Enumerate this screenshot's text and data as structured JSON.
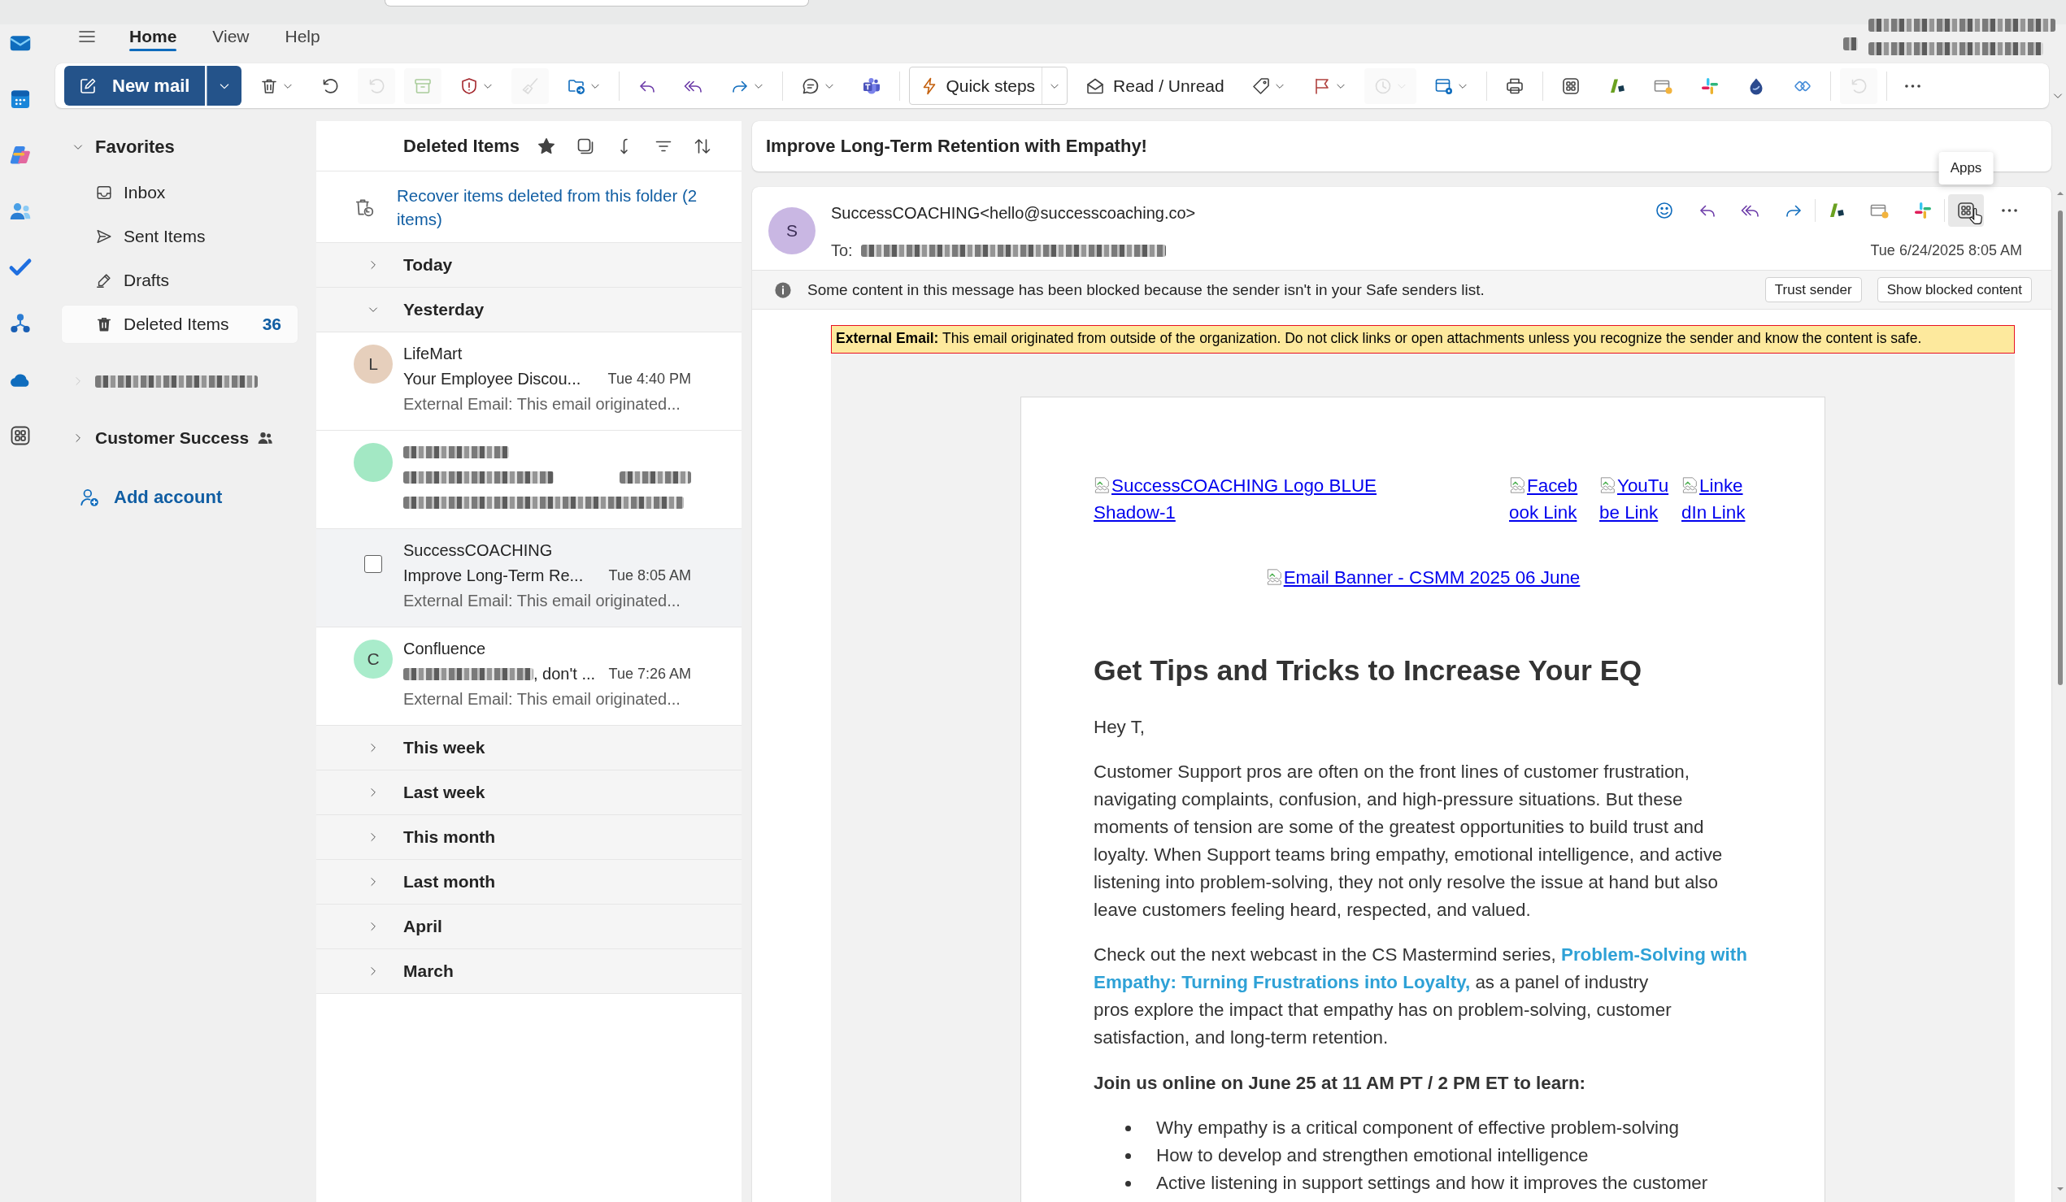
{
  "ribbon": {
    "tabs": [
      {
        "label": "Home",
        "selected": true
      },
      {
        "label": "View",
        "selected": false
      },
      {
        "label": "Help",
        "selected": false
      }
    ],
    "account_blurred": true
  },
  "toolbar": {
    "groups": [
      [
        {
          "kind": "primary",
          "label": "New mail",
          "menu": true,
          "disabled": false
        },
        {
          "kind": "icon",
          "menu": true,
          "disabled": false
        },
        {
          "kind": "icon",
          "menu": false,
          "disabled": false
        },
        {
          "kind": "icon",
          "menu": false,
          "disabled": true
        },
        {
          "kind": "icon",
          "menu": false,
          "disabled": true
        },
        {
          "kind": "icon",
          "menu": true,
          "disabled": false
        },
        {
          "kind": "icon",
          "menu": false,
          "disabled": true
        },
        {
          "kind": "icon",
          "menu": true,
          "disabled": false
        }
      ],
      [
        {
          "kind": "icon",
          "menu": false,
          "disabled": false
        },
        {
          "kind": "icon",
          "menu": false,
          "disabled": false
        },
        {
          "kind": "icon",
          "menu": true,
          "disabled": false
        }
      ],
      [
        {
          "kind": "icon",
          "menu": true,
          "disabled": false
        },
        {
          "kind": "icon",
          "menu": false,
          "disabled": false
        }
      ],
      [
        {
          "kind": "outlined",
          "label": "Quick steps",
          "menu": true,
          "disabled": false
        },
        {
          "kind": "text",
          "label": "Read / Unread",
          "menu": false,
          "disabled": false
        },
        {
          "kind": "icon",
          "menu": true,
          "disabled": false
        },
        {
          "kind": "icon",
          "menu": true,
          "disabled": false
        },
        {
          "kind": "icon",
          "menu": true,
          "disabled": true
        },
        {
          "kind": "icon",
          "menu": true,
          "disabled": false
        }
      ],
      [
        {
          "kind": "icon",
          "menu": false,
          "disabled": false
        }
      ],
      [
        {
          "kind": "icon",
          "menu": false,
          "disabled": false
        },
        {
          "kind": "icon",
          "menu": false,
          "disabled": false
        },
        {
          "kind": "icon",
          "menu": false,
          "disabled": false
        },
        {
          "kind": "icon",
          "menu": false,
          "disabled": false
        },
        {
          "kind": "icon",
          "menu": false,
          "disabled": false
        },
        {
          "kind": "icon",
          "menu": false,
          "disabled": false
        }
      ],
      [
        {
          "kind": "icon",
          "menu": false,
          "disabled": true
        }
      ],
      [
        {
          "kind": "icon",
          "menu": false,
          "disabled": false
        }
      ]
    ]
  },
  "folder_pane": {
    "favorites": {
      "label": "Favorites",
      "expanded": true,
      "items": [
        {
          "label": "Inbox",
          "selected": false
        },
        {
          "label": "Sent Items",
          "selected": false
        },
        {
          "label": "Drafts",
          "selected": false
        },
        {
          "label": "Deleted Items",
          "selected": true,
          "count": "36"
        }
      ]
    },
    "accounts": [
      {
        "kind": "redacted",
        "expanded": false
      },
      {
        "kind": "group",
        "label": "Customer Success",
        "expanded": false
      }
    ],
    "add_account": "Add account"
  },
  "message_list": {
    "title": "Deleted Items",
    "favorite": true,
    "recover_link": "Recover items deleted from this folder (2 items)",
    "groups": [
      {
        "label": "Today",
        "expanded": false
      },
      {
        "label": "Yesterday",
        "expanded": true,
        "messages": [
          {
            "kind": "mail",
            "sender": "LifeMart",
            "subject": "Your Employee Discou...",
            "time": "Tue 4:40 PM",
            "preview": "External Email: This email originated...",
            "initial": "L",
            "color": "#e6cfbc",
            "selected": false
          },
          {
            "kind": "redacted",
            "color": "#a3e8c4",
            "selected": false
          },
          {
            "kind": "mail",
            "sender": "SuccessCOACHING",
            "subject": "Improve Long-Term Re...",
            "time": "Tue 8:05 AM",
            "preview": "External Email: This email originated...",
            "selected": true
          },
          {
            "kind": "mail",
            "sender": "Confluence",
            "subject": ", don't ...",
            "subject_redacted_prefix": true,
            "time": "Tue 7:26 AM",
            "preview": "External Email: This email originated...",
            "initial": "C",
            "color": "#a9eccb",
            "selected": false
          }
        ]
      },
      {
        "label": "This week",
        "expanded": false
      },
      {
        "label": "Last week",
        "expanded": false
      },
      {
        "label": "This month",
        "expanded": false
      },
      {
        "label": "Last month",
        "expanded": false
      },
      {
        "label": "April",
        "expanded": false
      },
      {
        "label": "March",
        "expanded": false
      }
    ]
  },
  "reading_pane": {
    "subject": "Improve Long-Term Retention with Empathy!",
    "sender": {
      "initial": "S",
      "color": "#c9b7e3",
      "address": "SuccessCOACHING<hello@successcoaching.co>"
    },
    "to_label": "To:",
    "recipients_redacted": true,
    "date": "Tue 6/24/2025 8:05 AM",
    "action_groups": [
      [
        {
          "hovered": false
        },
        {
          "hovered": false
        },
        {
          "hovered": false
        },
        {
          "hovered": false
        }
      ],
      [
        {
          "hovered": false
        },
        {
          "hovered": false
        },
        {
          "hovered": false
        }
      ],
      [
        {
          "hovered": true,
          "tooltip": "Apps"
        },
        {
          "hovered": false
        }
      ]
    ],
    "blocked_notice": {
      "text": "Some content in this message has been blocked because the sender isn't in your Safe senders list.",
      "buttons": [
        "Trust sender",
        "Show blocked content"
      ]
    },
    "external_banner": "**External Email:** This email originated from outside of the organization. Do not click links or open attachments unless you recognize the sender and know the content is safe.",
    "newsletter": {
      "logo_link": "SuccessCOACHING Logo BLUE Shadow-1",
      "social_links": [
        "Facebook Link",
        "YouTube Link",
        "LinkedIn Link"
      ],
      "banner_link": "Email Banner - CSMM 2025 06 June",
      "heading": "Get Tips and Tricks to Increase Your EQ",
      "greeting": "Hey T,",
      "paragraphs": [
        "Customer Support pros are often on the front lines of customer frustration, navigating complaints, confusion, and high-pressure situations. But these moments of tension are some of the greatest opportunities to build trust and loyalty. When Support teams bring empathy, emotional intelligence, and active listening into problem-solving, they not only resolve the issue at hand but also leave customers feeling heard, respected, and valued.",
        "Check out the next webcast in the CS Mastermind series, **Problem-Solving with Empathy: Turning Frustrations into Loyalty,** as a panel of industry\npros explore the impact that empathy has on problem-solving, customer satisfaction, and long-term retention."
      ],
      "signup": "Join us online on June 25 at 11 AM PT / 2 PM ET to learn:",
      "bullets": [
        "Why empathy is a critical component of effective problem-solving",
        "How to develop and strengthen emotional intelligence",
        "Active listening in support settings and how it improves the customer"
      ]
    }
  }
}
